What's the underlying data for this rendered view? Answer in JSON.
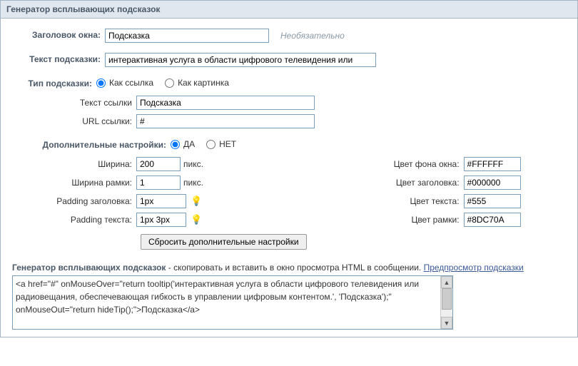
{
  "header": {
    "title": "Генератор всплывающих подсказок"
  },
  "fields": {
    "window_title_label": "Заголовок окна:",
    "window_title_value": "Подсказка",
    "optional_hint": "Необязательно",
    "tooltip_text_label": "Текст подсказки:",
    "tooltip_text_value": "интерактивная услуга в области цифрового телевидения или",
    "tip_type_label": "Тип подсказки:",
    "tip_type_opt_link": "Как ссылка",
    "tip_type_opt_image": "Как картинка",
    "link_text_label": "Текст ссылки",
    "link_text_value": "Подсказка",
    "link_url_label": "URL ссылки:",
    "link_url_value": "#",
    "extra_label": "Дополнительные настройки:",
    "extra_yes": "ДА",
    "extra_no": "НЕТ"
  },
  "settings": {
    "width_label": "Ширина:",
    "width_value": "200",
    "border_width_label": "Ширина рамки:",
    "border_width_value": "1",
    "pad_head_label": "Padding заголовка:",
    "pad_head_value": "1px",
    "pad_text_label": "Padding текста:",
    "pad_text_value": "1px 3px",
    "px_unit": "пикс.",
    "bg_color_label": "Цвет фона окна:",
    "bg_color_value": "#FFFFFF",
    "title_color_label": "Цвет заголовка:",
    "title_color_value": "#000000",
    "text_color_label": "Цвет текста:",
    "text_color_value": "#555",
    "border_color_label": "Цвет рамки:",
    "border_color_value": "#8DC70A",
    "reset_btn": "Сбросить дополнительные настройки"
  },
  "footer": {
    "caption_bold": "Генератор всплывающих подсказок",
    "caption_rest": " - скопировать и вставить в окно просмотра HTML в сообщении. ",
    "preview_link": "Предпросмотр подсказки",
    "code": "<a href=\"#\" onMouseOver=\"return tooltip('интерактивная услуга в области цифрового телевидения или радиовещания, обеспечевающая гибкость в управлении цифровым контентом.', 'Подсказка');\" onMouseOut=\"return hideTip();\">Подсказка</a>"
  }
}
